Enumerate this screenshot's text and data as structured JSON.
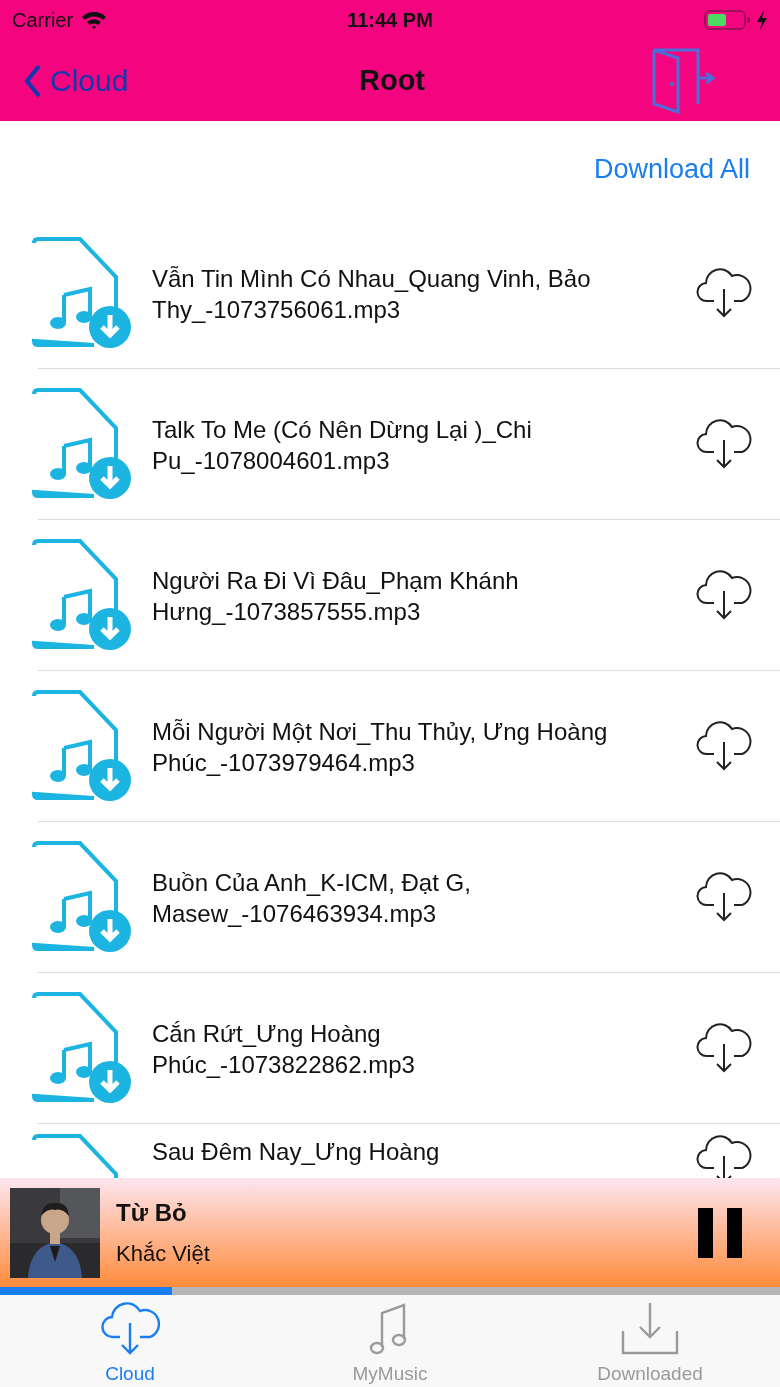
{
  "status_bar": {
    "carrier": "Carrier",
    "time": "11:44 PM"
  },
  "nav": {
    "back": "Cloud",
    "title": "Root"
  },
  "download_all": "Download All",
  "files": [
    {
      "name": "Vẫn Tin Mình Có Nhau_Quang Vinh, Bảo Thy_-1073756061.mp3"
    },
    {
      "name": "Talk To Me (Có Nên Dừng Lại )_Chi Pu_-1078004601.mp3"
    },
    {
      "name": "Người Ra Đi Vì Đâu_Phạm Khánh Hưng_-1073857555.mp3"
    },
    {
      "name": "Mỗi Người Một Nơi_Thu Thủy, Ưng Hoàng Phúc_-1073979464.mp3"
    },
    {
      "name": "Buồn Của Anh_K-ICM, Đạt G, Masew_-1076463934.mp3"
    },
    {
      "name": "Cắn Rứt_Ưng Hoàng Phúc_-1073822862.mp3"
    },
    {
      "name": "Sau Đêm Nay_Ưng Hoàng"
    }
  ],
  "player": {
    "title": "Từ Bỏ",
    "artist": "Khắc Việt",
    "playing": true,
    "level": 0.22
  },
  "tabs": [
    {
      "label": "Cloud",
      "selected": true
    },
    {
      "label": "MyMusic",
      "selected": false
    },
    {
      "label": "Downloaded",
      "selected": false
    }
  ]
}
